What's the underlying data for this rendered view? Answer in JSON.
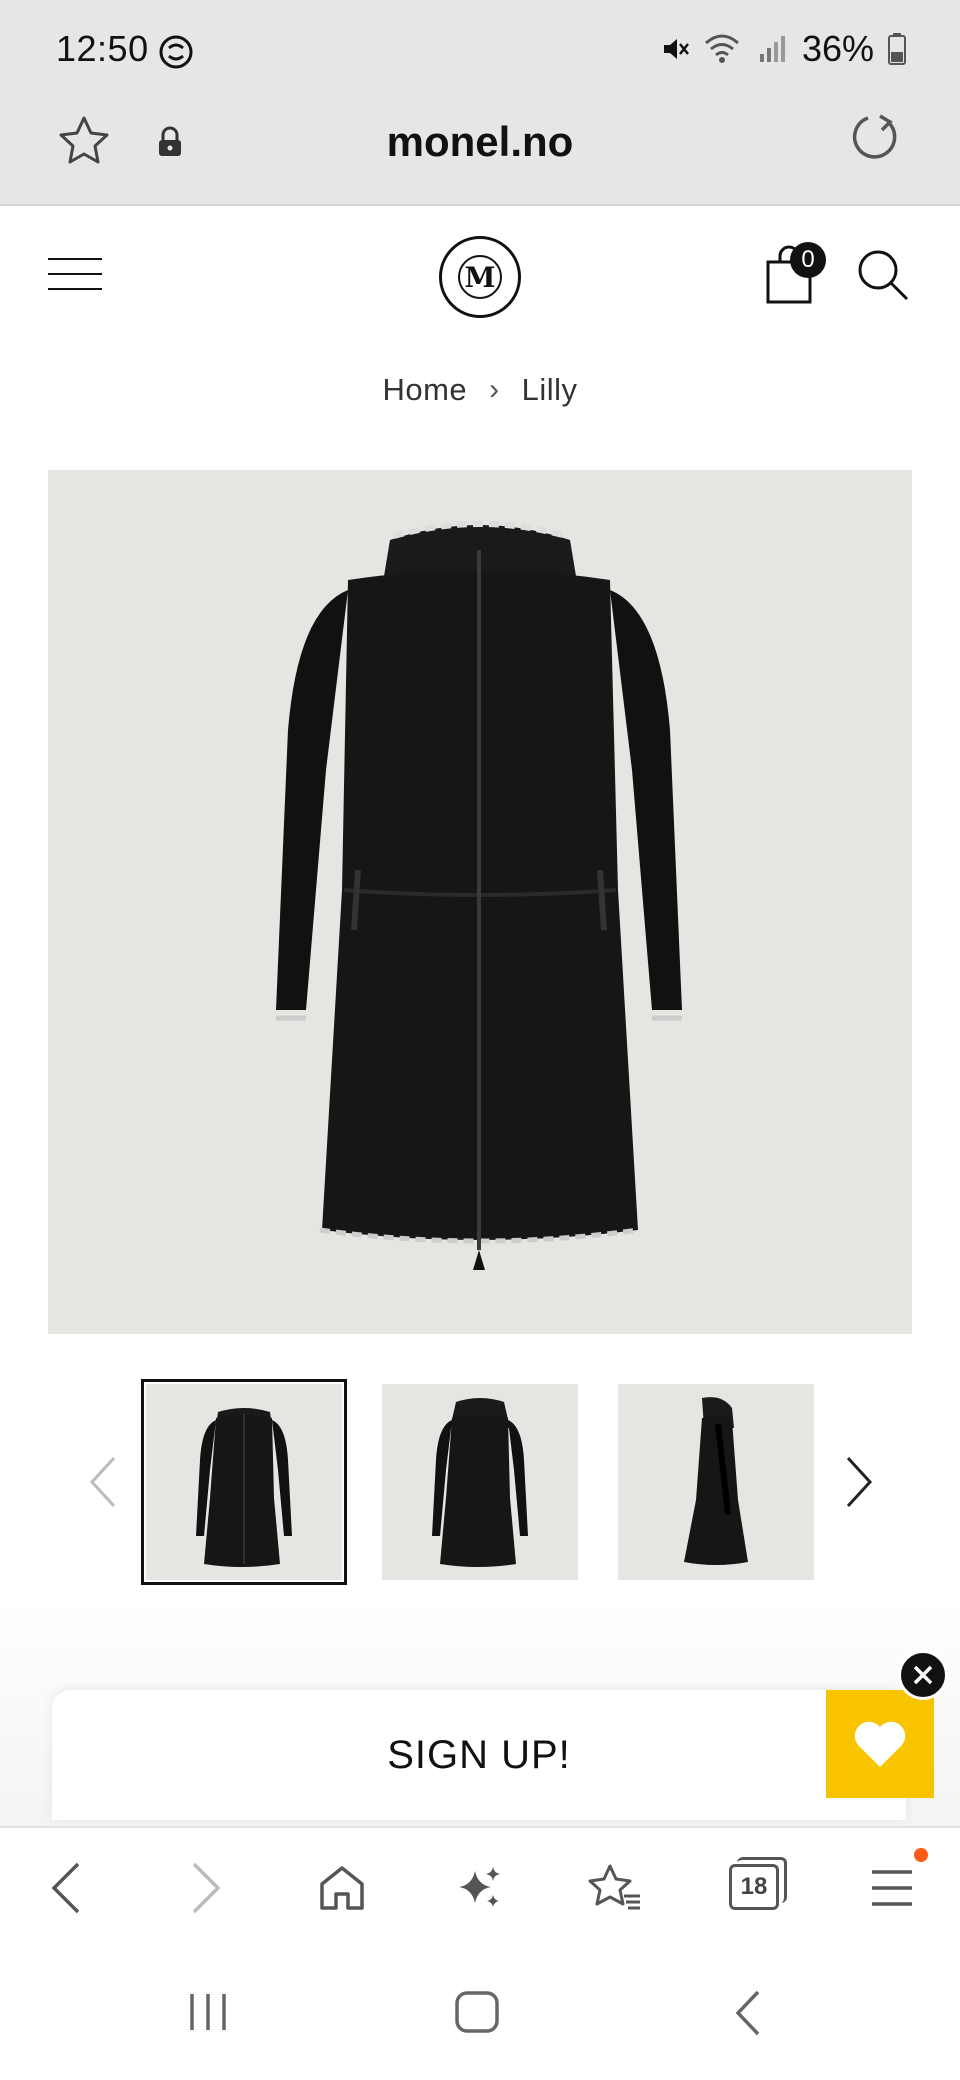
{
  "status_bar": {
    "time": "12:50",
    "battery": "36%",
    "icons": [
      "sync-icon",
      "mute-icon",
      "wifi-icon",
      "signal-icon",
      "battery-icon"
    ]
  },
  "browser": {
    "url": "monel.no",
    "icons": [
      "star-icon",
      "lock-icon",
      "reload-icon"
    ]
  },
  "site_header": {
    "logo_letter": "M",
    "cart_count": "0",
    "icons": [
      "hamburger-menu-icon",
      "shopping-bag-icon",
      "search-icon"
    ]
  },
  "breadcrumb": {
    "items": [
      "Home",
      "Lilly"
    ],
    "separator": "›"
  },
  "product": {
    "thumbnails": [
      "front-view",
      "back-view",
      "side-view"
    ],
    "selected_thumbnail": 0
  },
  "signup": {
    "label": "SIGN UP!"
  },
  "wishlist": {
    "color": "#f8c400",
    "icons": [
      "heart-icon",
      "close-icon"
    ]
  },
  "bottom_toolbar": {
    "tabs_count": "18",
    "items": [
      "back-icon",
      "forward-icon",
      "home-icon",
      "sparkle-icon",
      "bookmarks-icon",
      "tabs-icon",
      "menu-icon"
    ],
    "notification_color": "#ff5b14"
  }
}
